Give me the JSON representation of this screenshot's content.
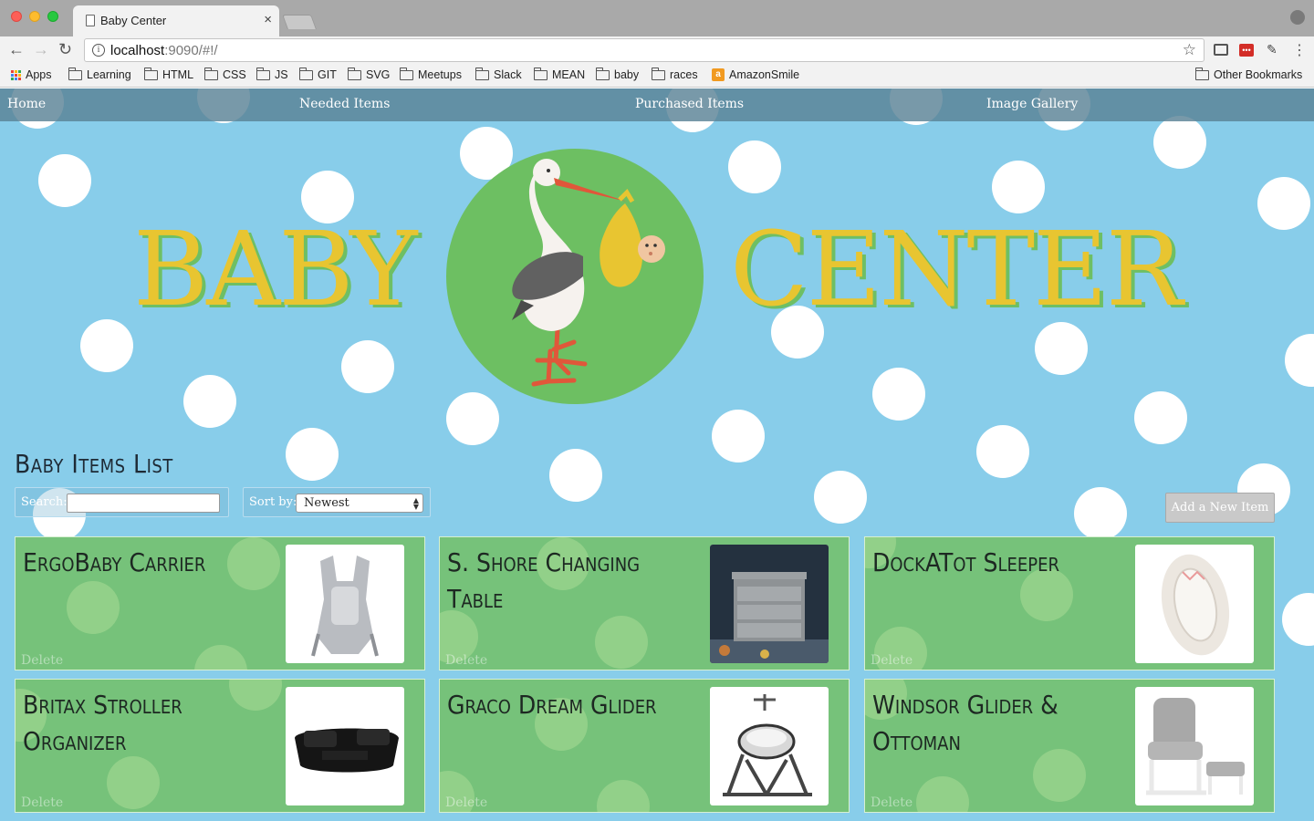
{
  "browser": {
    "tab_title": "Baby Center",
    "tab_close": "×",
    "url_host": "localhost",
    "url_rest": ":9090/#!/",
    "bookmarks": [
      {
        "label": "Apps",
        "icon": "apps-grid-icon"
      },
      {
        "label": "Learning",
        "icon": "folder-icon"
      },
      {
        "label": "HTML",
        "icon": "folder-icon"
      },
      {
        "label": "CSS",
        "icon": "folder-icon"
      },
      {
        "label": "JS",
        "icon": "folder-icon"
      },
      {
        "label": "GIT",
        "icon": "folder-icon"
      },
      {
        "label": "SVG",
        "icon": "folder-icon"
      },
      {
        "label": "Meetups",
        "icon": "folder-icon"
      },
      {
        "label": "Slack",
        "icon": "folder-icon"
      },
      {
        "label": "MEAN",
        "icon": "folder-icon"
      },
      {
        "label": "baby",
        "icon": "folder-icon"
      },
      {
        "label": "races",
        "icon": "folder-icon"
      },
      {
        "label": "AmazonSmile",
        "icon": "amazon-icon"
      }
    ],
    "other_bookmarks": "Other Bookmarks"
  },
  "nav": {
    "home": "Home",
    "needed": "Needed Items",
    "purchased": "Purchased Items",
    "gallery": "Image Gallery"
  },
  "hero": {
    "word_left": "BABY",
    "word_right": "CENTER"
  },
  "list": {
    "heading": "Baby Items List",
    "search_label": "Search:",
    "search_value": "",
    "sort_label": "Sort by:",
    "sort_value": "Newest",
    "add_button": "Add a New Item"
  },
  "items": [
    {
      "name": "ErgoBaby Carrier",
      "delete": "Delete",
      "image": "baby-carrier-image"
    },
    {
      "name": "S. Shore Changing Table",
      "delete": "Delete",
      "image": "changing-table-image"
    },
    {
      "name": "DockATot Sleeper",
      "delete": "Delete",
      "image": "baby-lounger-image"
    },
    {
      "name": "Britax Stroller Organizer",
      "delete": "Delete",
      "image": "stroller-organizer-image"
    },
    {
      "name": "Graco Dream Glider",
      "delete": "Delete",
      "image": "baby-glider-image"
    },
    {
      "name": "Windsor Glider & Ottoman",
      "delete": "Delete",
      "image": "glider-ottoman-image"
    }
  ],
  "colors": {
    "background": "#88cdea",
    "title_yellow": "#e8c531",
    "title_shadow": "#6ebf64",
    "card_green": "#76c27a",
    "logo_green": "#6dbf62"
  }
}
